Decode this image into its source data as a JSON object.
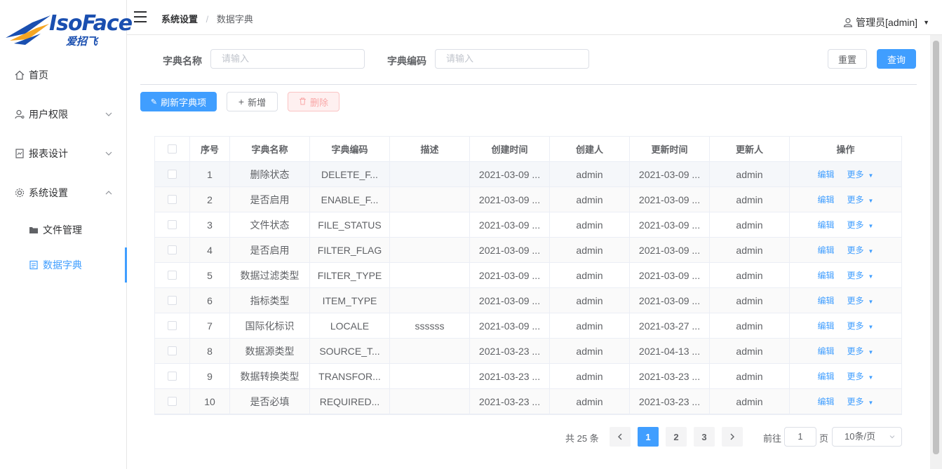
{
  "brand": {
    "name": "IsoFace",
    "subtitle": "爱招飞"
  },
  "sidebar": {
    "items": [
      {
        "label": "首页",
        "icon": "home-icon"
      },
      {
        "label": "用户权限",
        "icon": "user-permission-icon"
      },
      {
        "label": "报表设计",
        "icon": "report-icon"
      },
      {
        "label": "系统设置",
        "icon": "gear-icon"
      }
    ],
    "sub_items": [
      {
        "label": "文件管理",
        "icon": "folder-icon"
      },
      {
        "label": "数据字典",
        "icon": "document-icon"
      }
    ]
  },
  "header": {
    "breadcrumb": [
      "系统设置",
      "数据字典"
    ],
    "separator": "/",
    "user": "管理员[admin]"
  },
  "search": {
    "name_label": "字典名称",
    "name_placeholder": "请输入",
    "code_label": "字典编码",
    "code_placeholder": "请输入",
    "reset": "重置",
    "query": "查询"
  },
  "toolbar": {
    "refresh": "刷新字典项",
    "add": "新增",
    "delete": "删除"
  },
  "table": {
    "columns": [
      "序号",
      "字典名称",
      "字典编码",
      "描述",
      "创建时间",
      "创建人",
      "更新时间",
      "更新人",
      "操作"
    ],
    "rows": [
      [
        "1",
        "删除状态",
        "DELETE_F...",
        "",
        "2021-03-09 ...",
        "admin",
        "2021-03-09 ...",
        "admin"
      ],
      [
        "2",
        "是否启用",
        "ENABLE_F...",
        "",
        "2021-03-09 ...",
        "admin",
        "2021-03-09 ...",
        "admin"
      ],
      [
        "3",
        "文件状态",
        "FILE_STATUS",
        "",
        "2021-03-09 ...",
        "admin",
        "2021-03-09 ...",
        "admin"
      ],
      [
        "4",
        "是否启用",
        "FILTER_FLAG",
        "",
        "2021-03-09 ...",
        "admin",
        "2021-03-09 ...",
        "admin"
      ],
      [
        "5",
        "数据过滤类型",
        "FILTER_TYPE",
        "",
        "2021-03-09 ...",
        "admin",
        "2021-03-09 ...",
        "admin"
      ],
      [
        "6",
        "指标类型",
        "ITEM_TYPE",
        "",
        "2021-03-09 ...",
        "admin",
        "2021-03-09 ...",
        "admin"
      ],
      [
        "7",
        "国际化标识",
        "LOCALE",
        "ssssss",
        "2021-03-09 ...",
        "admin",
        "2021-03-27 ...",
        "admin"
      ],
      [
        "8",
        "数据源类型",
        "SOURCE_T...",
        "",
        "2021-03-23 ...",
        "admin",
        "2021-04-13 ...",
        "admin"
      ],
      [
        "9",
        "数据转换类型",
        "TRANSFOR...",
        "",
        "2021-03-23 ...",
        "admin",
        "2021-03-23 ...",
        "admin"
      ],
      [
        "10",
        "是否必填",
        "REQUIRED...",
        "",
        "2021-03-23 ...",
        "admin",
        "2021-03-23 ...",
        "admin"
      ]
    ],
    "op_edit": "编辑",
    "op_more": "更多"
  },
  "pagination": {
    "total": "共 25 条",
    "pages": [
      "1",
      "2",
      "3"
    ],
    "current": "1",
    "goto_label": "前往",
    "goto_value": "1",
    "page_unit": "页",
    "page_size": "10条/页"
  },
  "colors": {
    "primary": "#409eff",
    "danger_bg": "#fef0f0"
  }
}
